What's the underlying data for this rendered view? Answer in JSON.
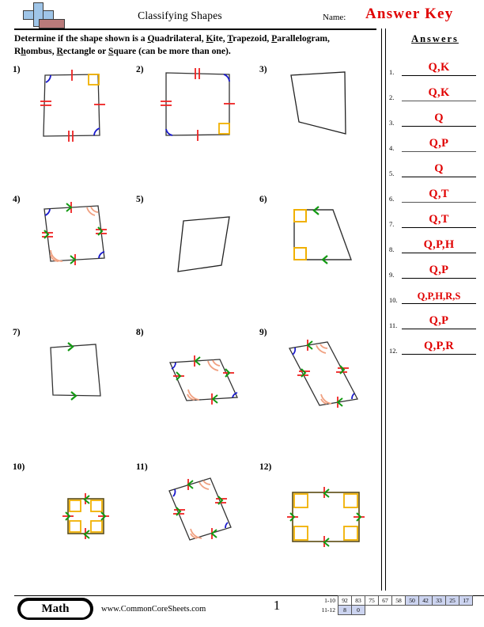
{
  "header": {
    "title": "Classifying Shapes",
    "name_label": "Name:",
    "answer_key": "Answer Key",
    "logo_icon": "commoncoresheets-logo-icon"
  },
  "instructions": {
    "line1_pre": "Determine if the shape shown is a ",
    "terms": [
      "Quadrilateral",
      "Kite",
      "Trapezoid",
      "Parallelogram",
      "Rhombus",
      "Rectangle",
      "Square"
    ],
    "line2_tail": " (can be more than one)."
  },
  "answers_panel": {
    "heading": "Answers",
    "rows": [
      {
        "num": "1.",
        "value": "Q,K"
      },
      {
        "num": "2.",
        "value": "Q,K"
      },
      {
        "num": "3.",
        "value": "Q"
      },
      {
        "num": "4.",
        "value": "Q,P"
      },
      {
        "num": "5.",
        "value": "Q"
      },
      {
        "num": "6.",
        "value": "Q,T"
      },
      {
        "num": "7.",
        "value": "Q,T"
      },
      {
        "num": "8.",
        "value": "Q,P,H"
      },
      {
        "num": "9.",
        "value": "Q,P"
      },
      {
        "num": "10.",
        "value": "Q,P,H,R,S"
      },
      {
        "num": "11.",
        "value": "Q,P"
      },
      {
        "num": "12.",
        "value": "Q,P,R"
      }
    ]
  },
  "problems": [
    {
      "num": "1)",
      "shape": "kite-square-upright"
    },
    {
      "num": "2)",
      "shape": "kite-square-upright"
    },
    {
      "num": "3)",
      "shape": "irregular-quadrilateral"
    },
    {
      "num": "4)",
      "shape": "parallelogram"
    },
    {
      "num": "5)",
      "shape": "irregular-quadrilateral"
    },
    {
      "num": "6)",
      "shape": "right-trapezoid"
    },
    {
      "num": "7)",
      "shape": "trapezoid"
    },
    {
      "num": "8)",
      "shape": "rhombus"
    },
    {
      "num": "9)",
      "shape": "parallelogram-tilted"
    },
    {
      "num": "10)",
      "shape": "square"
    },
    {
      "num": "11)",
      "shape": "parallelogram-tilted"
    },
    {
      "num": "12)",
      "shape": "rectangle"
    }
  ],
  "footer": {
    "subject_badge": "Math",
    "website": "www.CommonCoreSheets.com",
    "page_number": "1"
  },
  "grading_scale": {
    "row1_label": "1-10",
    "row1": [
      "92",
      "83",
      "75",
      "67",
      "58",
      "50",
      "42",
      "33",
      "25",
      "17"
    ],
    "row1_highlight_from": 5,
    "row2_label": "11-12",
    "row2": [
      "8",
      "0"
    ],
    "highlight_color": "#ccd4f0"
  },
  "mark_colors": {
    "tick": "#ee2222",
    "arrow": "#119911",
    "right_angle": "#f0b000",
    "angle_blue": "#1a1acc",
    "angle_orange": "#f0a080",
    "outline": "#333333"
  }
}
